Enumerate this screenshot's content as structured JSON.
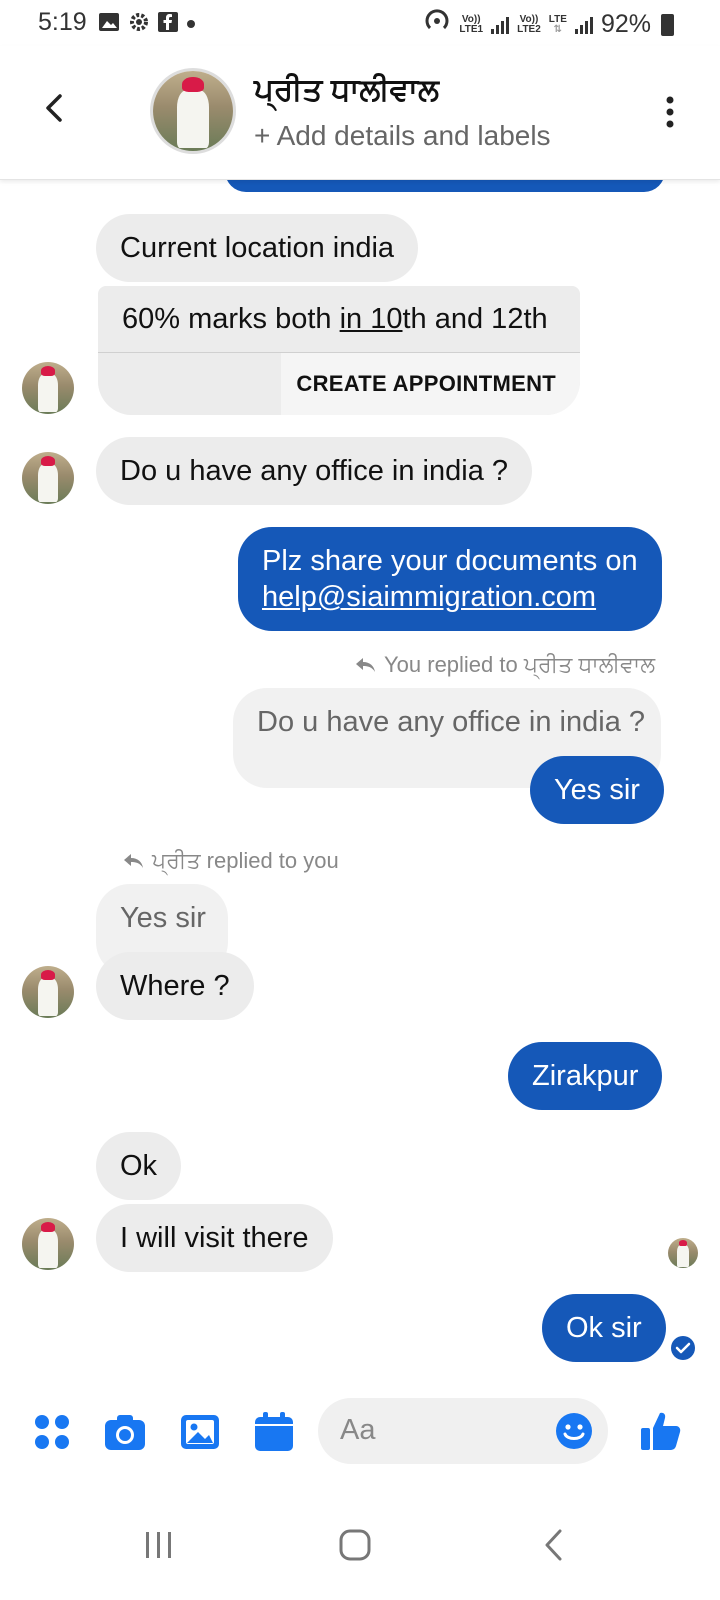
{
  "status_bar": {
    "time": "5:19",
    "battery": "92%",
    "sim1": "LTE1",
    "sim2": "LTE2",
    "volte": "Vo))",
    "lte": "LTE"
  },
  "header": {
    "contact_name": "ਪ੍ਰੀਤ ਧਾਲੀਵਾਲ",
    "subtitle": "+ Add details and labels"
  },
  "messages": {
    "m1": "Current location india",
    "m2_pre": "60% marks both ",
    "m2_underline": "in 10",
    "m2_post": "th and 12th",
    "create_appointment": "CREATE APPOINTMENT",
    "m3": "Do u have any office in india ?",
    "m4_line1": "Plz share your documents on",
    "m4_link": "help@siaimmigration.com",
    "reply_note_you": "You replied to ਪ੍ਰੀਤ ਧਾਲੀਵਾਲ",
    "quoted_1": "Do u have any office in india ?",
    "m5": "Yes sir",
    "reply_note_them": "ਪ੍ਰੀਤ replied to you",
    "quoted_2": "Yes sir",
    "m6": "Where ?",
    "m7": "Zirakpur",
    "m8": "Ok",
    "m9": "I will visit there",
    "m10": "Ok sir"
  },
  "composer": {
    "placeholder": "Aa"
  },
  "colors": {
    "accent": "#1558b8",
    "icon_blue": "#1877f2",
    "incoming_bubble": "#ececec"
  },
  "icons": [
    "back-arrow-icon",
    "more-vertical-icon",
    "apps-icon",
    "camera-icon",
    "image-icon",
    "calendar-icon",
    "emoji-icon",
    "thumbs-up-icon",
    "recent-apps-icon",
    "home-icon",
    "nav-back-icon",
    "reply-arrow-icon"
  ]
}
